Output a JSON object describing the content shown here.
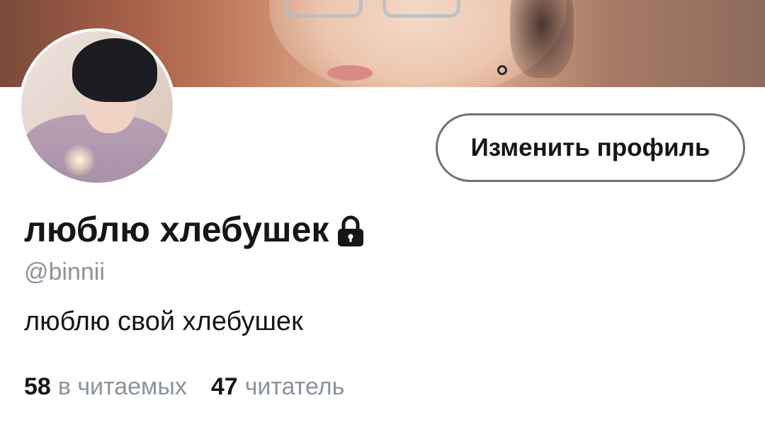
{
  "profile": {
    "display_name": "люблю хлебушек",
    "handle": "@binnii",
    "bio": "люблю свой хлебушек",
    "protected_icon": "lock-icon",
    "edit_button_label": "Изменить профиль",
    "stats": {
      "following_count": "58",
      "following_label": "в читаемых",
      "followers_count": "47",
      "followers_label": "читатель"
    }
  },
  "colors": {
    "text_primary": "#14171a",
    "text_secondary": "#8a939b",
    "button_border": "#6e7379",
    "background": "#ffffff"
  }
}
